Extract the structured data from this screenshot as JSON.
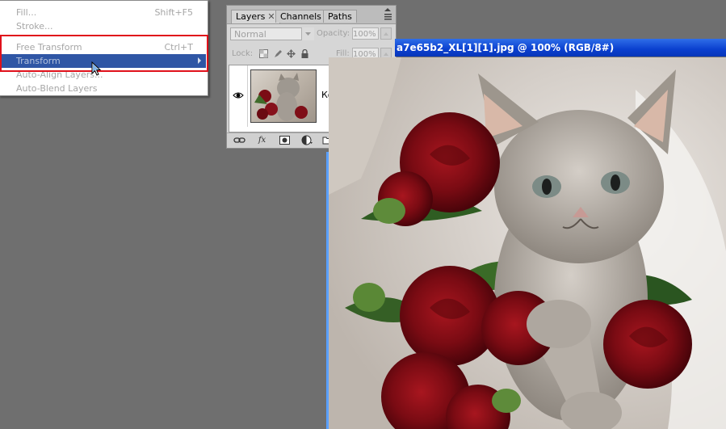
{
  "menu": {
    "items": [
      {
        "label": "Fill...",
        "shortcut": "Shift+F5"
      },
      {
        "label": "Stroke...",
        "shortcut": ""
      },
      {
        "label": "Free Transform",
        "shortcut": "Ctrl+T"
      },
      {
        "label": "Transform",
        "shortcut": ""
      },
      {
        "label": "Auto-Align Layers...",
        "shortcut": ""
      },
      {
        "label": "Auto-Blend Layers",
        "shortcut": ""
      }
    ]
  },
  "layers_panel": {
    "tabs": [
      "Layers",
      "Channels",
      "Paths"
    ],
    "blend_mode": "Normal",
    "opacity_label": "Opacity:",
    "opacity_value": "100%",
    "lock_label": "Lock:",
    "fill_label": "Fill:",
    "fill_value": "100%",
    "layer_name": "Кошечка"
  },
  "document": {
    "title": "a7e65b2_XL[1][1].jpg @ 100% (RGB/8#)"
  },
  "colors": {
    "menu_highlight": "#2f56a5",
    "annotation_box": "#e0111b",
    "title_bar": "#0a3fcf"
  },
  "icons": [
    "submenu-arrow-icon",
    "mouse-cursor-icon",
    "close-tab-icon",
    "panel-menu-icon",
    "eye-icon",
    "lock-transparent-icon",
    "lock-paint-icon",
    "lock-move-icon",
    "lock-all-icon",
    "link-layers-icon",
    "fx-icon",
    "mask-icon",
    "adjustment-layer-icon",
    "folder-icon",
    "new-layer-icon",
    "trash-icon"
  ]
}
